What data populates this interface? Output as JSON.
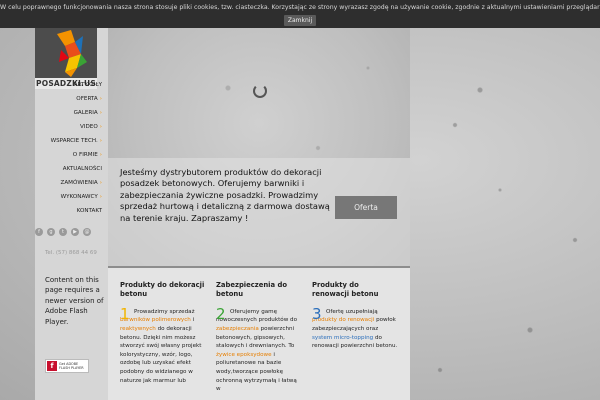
{
  "cookie": {
    "message": "W celu poprawnego funkcjonowania nasza strona stosuje pliki cookies, tzw. ciasteczka. Korzystając ze strony wyrazasz zgodę na używanie cookie, zgodnie z aktualnymi ustawieniami przeglądarki.",
    "close_label": "Zamknij"
  },
  "logo": {
    "text": "POSADZKI.US"
  },
  "nav": {
    "items": [
      {
        "label": "ARTYKUŁY",
        "arrow": ""
      },
      {
        "label": "OFERTA",
        "arrow": "›"
      },
      {
        "label": "GALERIA",
        "arrow": "›"
      },
      {
        "label": "VIDEO",
        "arrow": "›"
      },
      {
        "label": "WSPARCIE TECH.",
        "arrow": "›"
      },
      {
        "label": "O FIRMIE",
        "arrow": "›"
      },
      {
        "label": "AKTUALNOŚCI",
        "arrow": ""
      },
      {
        "label": "ZAMÓWIENIA",
        "arrow": "›"
      },
      {
        "label": "WYKONAWCY",
        "arrow": "›"
      },
      {
        "label": "KONTAKT",
        "arrow": ""
      }
    ]
  },
  "social": {
    "icons": [
      "facebook-icon",
      "google-plus-icon",
      "twitter-icon",
      "youtube-icon",
      "email-icon"
    ]
  },
  "contact": {
    "phone": "Tel. (57) 868 44 69"
  },
  "flash": {
    "message": "Content on this page requires a newer version of Adobe Flash Player.",
    "badge_line1": "Get ADOBE",
    "badge_line2": "FLASH PLAYER"
  },
  "intro": {
    "text": "Jesteśmy dystrybutorem produktów do dekoracji posadzek betonowych. Oferujemy barwniki i zabezpieczania żywiczne posadzki. Prowadzimy sprzedaż hurtową i detaliczną z darmowa dostawą na terenie kraju. Zapraszamy !",
    "button_label": "Oferta"
  },
  "products": [
    {
      "title": "Produkty do dekoracji betonu",
      "number": "1",
      "number_color": "#f2b400",
      "parts": [
        "Prowadzimy sprzedaż ",
        "barwników polimerowych",
        " i ",
        "reaktywnych",
        " do dekoracji betonu. Dzięki nim możesz stworzyć swój własny projekt kolorystyczny, wzór, logo, ozdobę lub uzyskać efekt podobny do widzianego w naturze jak marmur lub"
      ]
    },
    {
      "title": "Zabezpieczenia do betonu",
      "number": "2",
      "number_color": "#3aa335",
      "parts": [
        "Oferujemy gamę nowoczesnych produktów do ",
        "zabezpieczania",
        " powierzchni betonowych, gipsowych, stalowych i drewnianych. To ",
        "żywice epoksydowe",
        " i poliuretanowe na bazie wody,tworzące powłokę ochronną wytrzymałą i łatwą w"
      ]
    },
    {
      "title": "Produkty do renowacji betonu",
      "number": "3",
      "number_color": "#2a6ebb",
      "parts": [
        "Ofertę uzupełniają ",
        "produkty do renowacji",
        " powłok zabezpieczających oraz ",
        "system micro-topping",
        " do renowacji powierzchni betonu."
      ]
    }
  ]
}
